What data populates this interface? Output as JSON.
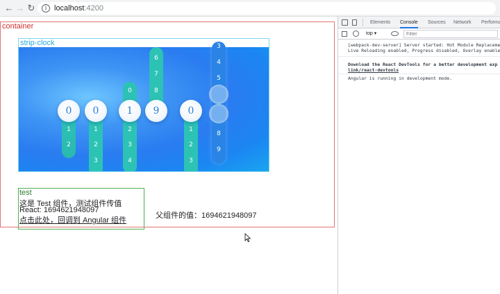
{
  "browser": {
    "url_host": "localhost",
    "url_port": ":4200"
  },
  "page": {
    "container_label": "container",
    "strip_label": "strip-clock",
    "clock": {
      "digits": [
        "0",
        "0",
        "1",
        "9",
        "0"
      ],
      "col_a_numbers": [
        "1",
        "2"
      ],
      "col_b_numbers": [
        "1",
        "2",
        "3"
      ],
      "col_c_numbers": [
        "0",
        "2",
        "3",
        "4"
      ],
      "col_d_numbers": [
        "6",
        "7",
        "8"
      ],
      "col_e_numbers": [
        "1",
        "2",
        "3"
      ],
      "col_f_numbers": [
        "3",
        "4",
        "5",
        "8",
        "9"
      ]
    },
    "test": {
      "title": "test",
      "line1": "这是 Test 组件，测试组件传值",
      "line2": "React: 1694621948097",
      "link": "点击此处，回调到 Angular 组件"
    },
    "parent_value": "父组件的值：1694621948097"
  },
  "devtools": {
    "tabs": [
      "Elements",
      "Console",
      "Sources",
      "Network",
      "Performa"
    ],
    "context": "top",
    "filter_placeholder": "Filter",
    "logs": [
      "[webpack-dev-server] Server started: Hot Module Replaceme",
      "Live Reloading enabled, Progress disabled, Overlay enable",
      "Download the React DevTools for a better development exp",
      "link/react-devtools",
      "Angular is running in development mode."
    ]
  },
  "colors": {
    "container_border": "#e57373",
    "strip_border": "#7fd3ee",
    "test_border": "#4caf50",
    "column_teal": "#2cc3b5"
  }
}
